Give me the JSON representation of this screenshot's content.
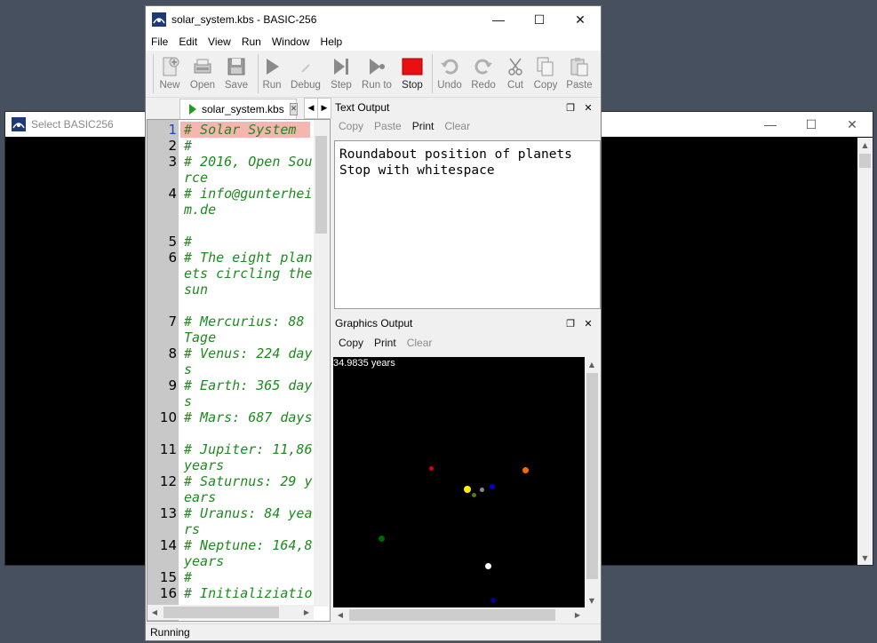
{
  "back_window": {
    "title": "Select BASIC256",
    "min_glyph": "—",
    "max_glyph": "☐",
    "close_glyph": "✕"
  },
  "main_window": {
    "title": "solar_system.kbs - BASIC-256",
    "min_glyph": "—",
    "max_glyph": "☐",
    "close_glyph": "✕"
  },
  "menu": [
    "File",
    "Edit",
    "View",
    "Run",
    "Window",
    "Help"
  ],
  "toolbar": {
    "new": "New",
    "open": "Open",
    "save": "Save",
    "run": "Run",
    "debug": "Debug",
    "step": "Step",
    "run_to": "Run to",
    "stop": "Stop",
    "undo": "Undo",
    "redo": "Redo",
    "cut": "Cut",
    "copy": "Copy",
    "paste": "Paste"
  },
  "editor": {
    "tab_label": "solar_system.kbs",
    "lines": [
      {
        "n": "1",
        "text": "# Solar System"
      },
      {
        "n": "2",
        "text": "#"
      },
      {
        "n": "3",
        "text": "# 2016, Open Source"
      },
      {
        "n": "4",
        "text": "# info@gunterheim.de"
      },
      {
        "n": "5",
        "text": "#"
      },
      {
        "n": "6",
        "text": "# The eight planets circling the sun"
      },
      {
        "n": "7",
        "text": "# Mercurius: 88 Tage"
      },
      {
        "n": "8",
        "text": "# Venus: 224 days"
      },
      {
        "n": "9",
        "text": "# Earth: 365 days"
      },
      {
        "n": "10",
        "text": "# Mars: 687 days"
      },
      {
        "n": "11",
        "text": "# Jupiter: 11,86 years"
      },
      {
        "n": "12",
        "text": "# Saturnus: 29 years"
      },
      {
        "n": "13",
        "text": "# Uranus: 84 years"
      },
      {
        "n": "14",
        "text": "# Neptune: 164,8 years"
      },
      {
        "n": "15",
        "text": "#"
      },
      {
        "n": "16",
        "text": "# Initializiatio"
      }
    ]
  },
  "text_output": {
    "title": "Text Output",
    "copy": "Copy",
    "paste": "Paste",
    "print": "Print",
    "clear": "Clear",
    "lines": [
      "Roundabout position of planets",
      "Stop with whitespace"
    ]
  },
  "graphics_output": {
    "title": "Graphics Output",
    "copy": "Copy",
    "print": "Print",
    "clear": "Clear",
    "years_label": "34.9835 years",
    "colors": {
      "sun": "#ffee00",
      "mercury": "#8a8a8a",
      "venus": "#5a7a1a",
      "earth": "#0000cc",
      "mars": "#dd0000",
      "jupiter": "#ff6600",
      "saturn": "#006600",
      "uranus": "#ffffff",
      "neptune": "#000099"
    }
  },
  "status": "Running"
}
